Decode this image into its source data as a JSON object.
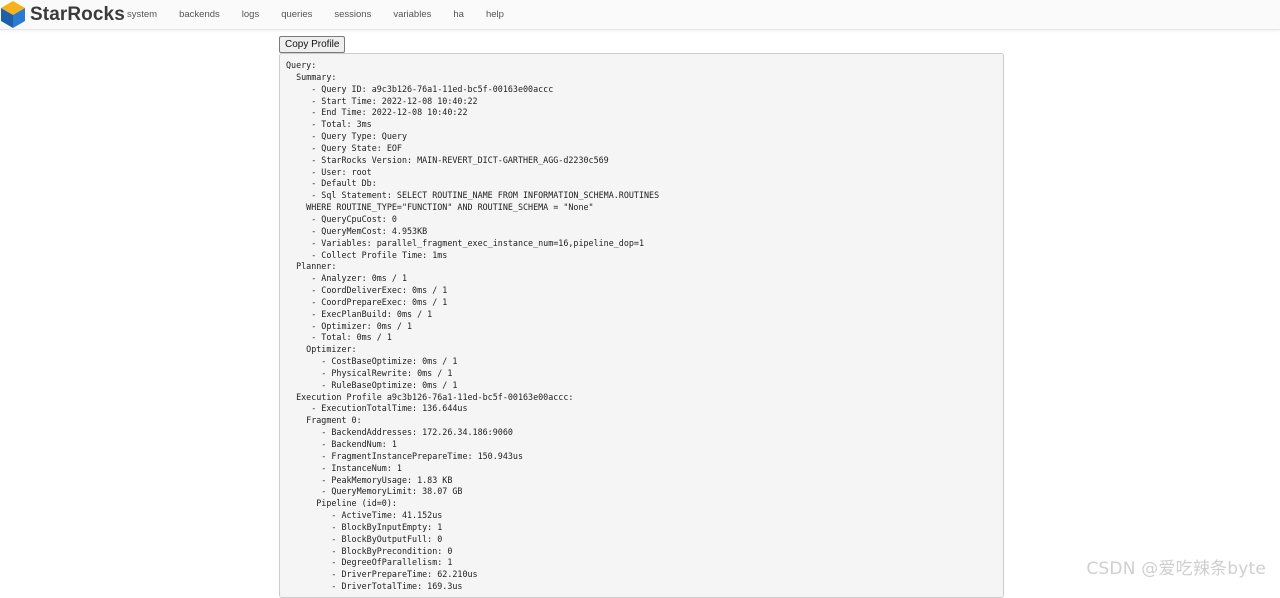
{
  "brand": {
    "name": "StarRocks",
    "logo_colors": [
      "#1f5fa8",
      "#f5b21b",
      "#2b7bd2"
    ]
  },
  "nav": {
    "items": [
      "system",
      "backends",
      "logs",
      "queries",
      "sessions",
      "variables",
      "ha",
      "help"
    ]
  },
  "copy_button": {
    "label": "Copy Profile"
  },
  "profile": {
    "lines": [
      "Query:",
      "  Summary:",
      "     - Query ID: a9c3b126-76a1-11ed-bc5f-00163e00accc",
      "     - Start Time: 2022-12-08 10:40:22",
      "     - End Time: 2022-12-08 10:40:22",
      "     - Total: 3ms",
      "     - Query Type: Query",
      "     - Query State: EOF",
      "     - StarRocks Version: MAIN-REVERT_DICT-GARTHER_AGG-d2230c569",
      "     - User: root",
      "     - Default Db:",
      "     - Sql Statement: SELECT ROUTINE_NAME FROM INFORMATION_SCHEMA.ROUTINES",
      "    WHERE ROUTINE_TYPE=\"FUNCTION\" AND ROUTINE_SCHEMA = \"None\"",
      "     - QueryCpuCost: 0",
      "     - QueryMemCost: 4.953KB",
      "     - Variables: parallel_fragment_exec_instance_num=16,pipeline_dop=1",
      "     - Collect Profile Time: 1ms",
      "  Planner:",
      "     - Analyzer: 0ms / 1",
      "     - CoordDeliverExec: 0ms / 1",
      "     - CoordPrepareExec: 0ms / 1",
      "     - ExecPlanBuild: 0ms / 1",
      "     - Optimizer: 0ms / 1",
      "     - Total: 0ms / 1",
      "    Optimizer:",
      "       - CostBaseOptimize: 0ms / 1",
      "       - PhysicalRewrite: 0ms / 1",
      "       - RuleBaseOptimize: 0ms / 1",
      "  Execution Profile a9c3b126-76a1-11ed-bc5f-00163e00accc:",
      "     - ExecutionTotalTime: 136.644us",
      "    Fragment 0:",
      "       - BackendAddresses: 172.26.34.186:9060",
      "       - BackendNum: 1",
      "       - FragmentInstancePrepareTime: 150.943us",
      "       - InstanceNum: 1",
      "       - PeakMemoryUsage: 1.83 KB",
      "       - QueryMemoryLimit: 38.07 GB",
      "      Pipeline (id=0):",
      "         - ActiveTime: 41.152us",
      "         - BlockByInputEmpty: 1",
      "         - BlockByOutputFull: 0",
      "         - BlockByPrecondition: 0",
      "         - DegreeOfParallelism: 1",
      "         - DriverPrepareTime: 62.210us",
      "         - DriverTotalTime: 169.3us"
    ]
  },
  "watermark": {
    "text": "CSDN @爱吃辣条byte"
  }
}
